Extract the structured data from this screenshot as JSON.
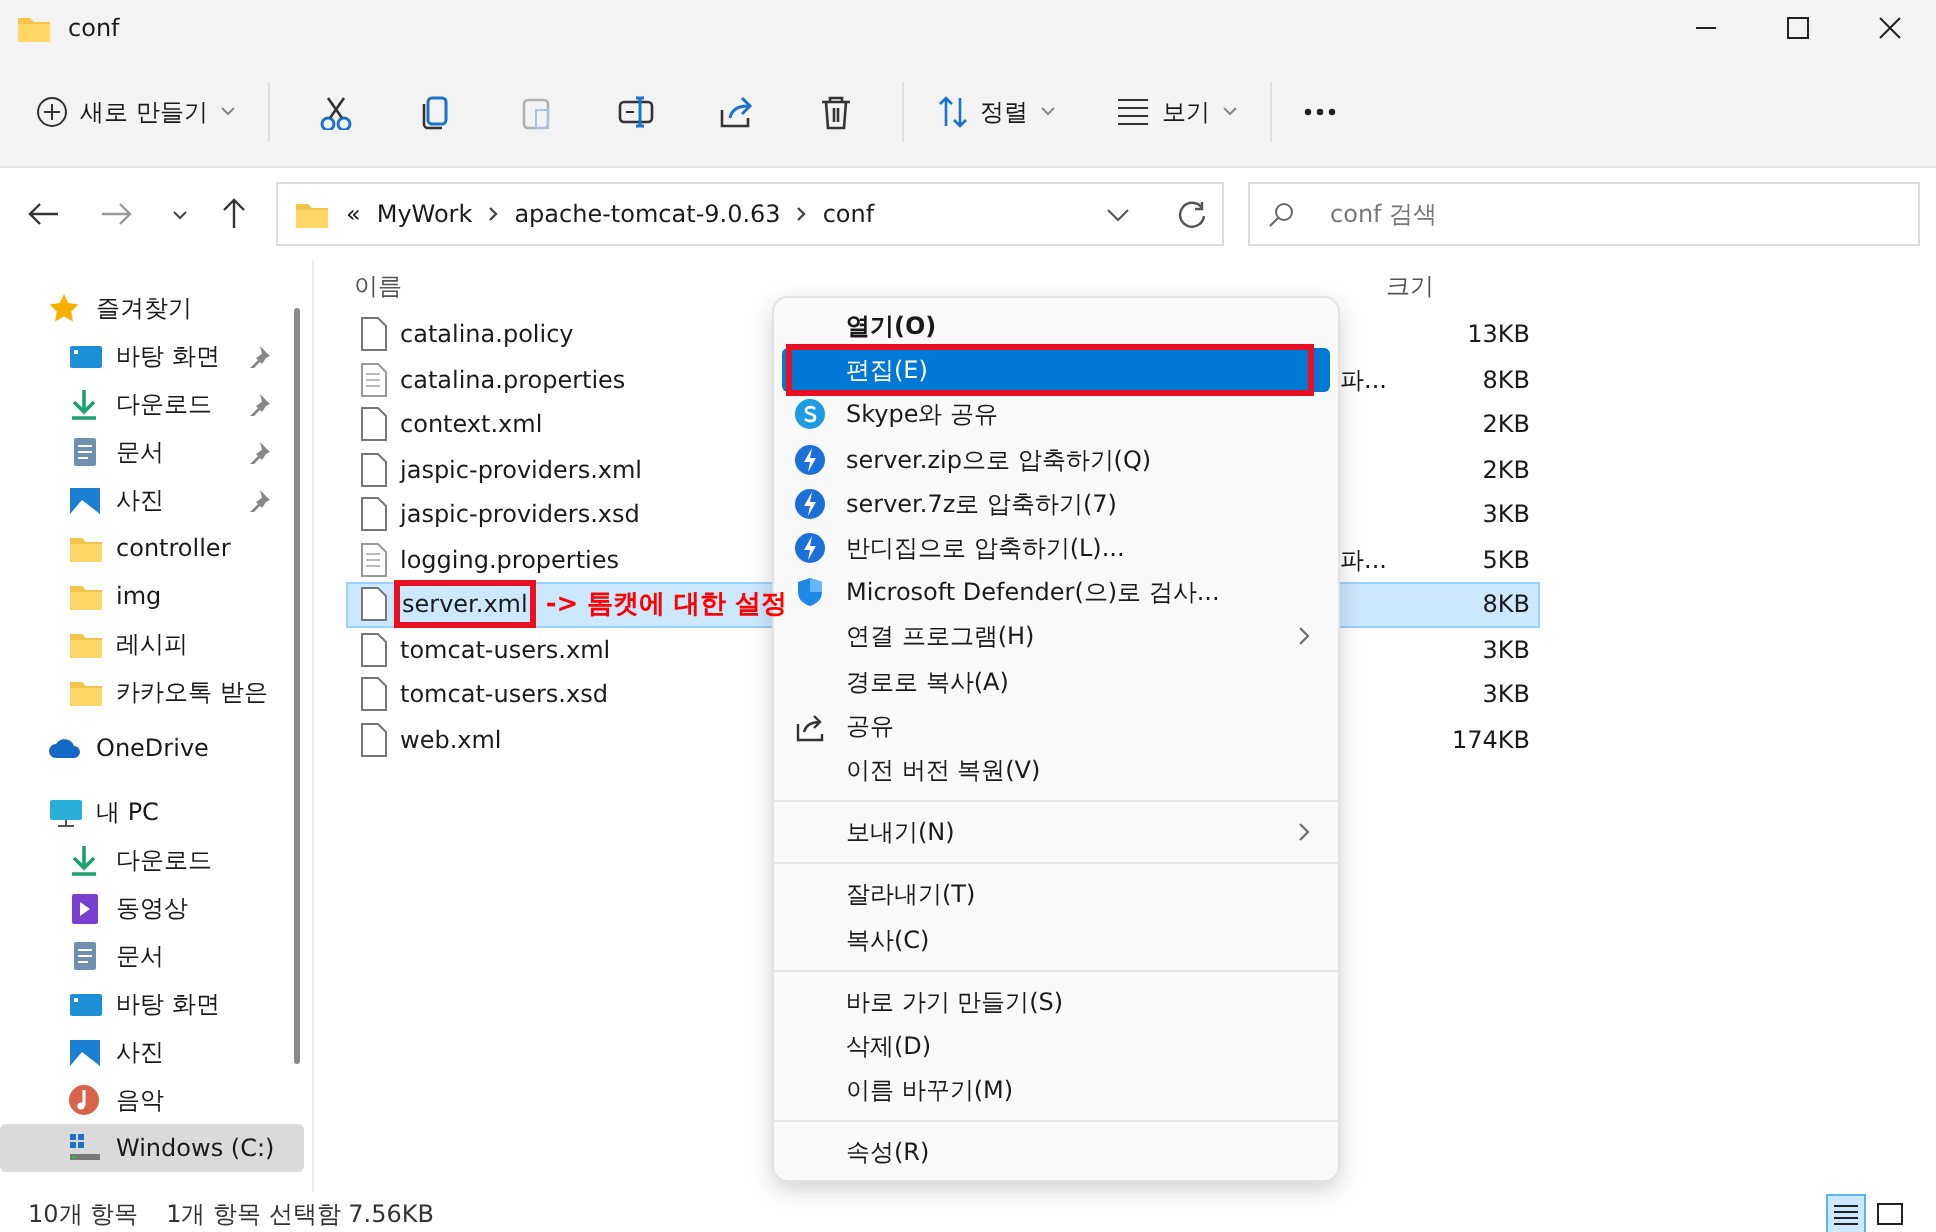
{
  "window": {
    "title": "conf"
  },
  "toolbar": {
    "new_label": "새로 만들기",
    "actions": [
      {
        "kind": "cut",
        "disabled": false
      },
      {
        "kind": "copy",
        "disabled": false
      },
      {
        "kind": "paste",
        "disabled": true
      },
      {
        "kind": "rename",
        "disabled": false
      },
      {
        "kind": "share",
        "disabled": false
      },
      {
        "kind": "delete",
        "disabled": false
      }
    ],
    "sort_label": "정렬",
    "view_label": "보기"
  },
  "address": {
    "overflow": "«",
    "crumbs": [
      "MyWork",
      "apache-tomcat-9.0.63",
      "conf"
    ],
    "search_placeholder": "conf 검색"
  },
  "sidebar": [
    {
      "label": "즐겨찾기",
      "kind": "star",
      "selected": false,
      "children": [
        {
          "label": "바탕 화면",
          "kind": "desktop",
          "pinned": true,
          "selected": false
        },
        {
          "label": "다운로드",
          "kind": "download",
          "pinned": true,
          "selected": false
        },
        {
          "label": "문서",
          "kind": "document",
          "pinned": true,
          "selected": false
        },
        {
          "label": "사진",
          "kind": "photo",
          "pinned": true,
          "selected": false
        },
        {
          "label": "controller",
          "kind": "folder",
          "pinned": false,
          "selected": false
        },
        {
          "label": "img",
          "kind": "folder",
          "pinned": false,
          "selected": false
        },
        {
          "label": "레시피",
          "kind": "folder",
          "pinned": false,
          "selected": false
        },
        {
          "label": "카카오톡 받은",
          "kind": "folder",
          "pinned": false,
          "selected": false
        }
      ]
    },
    {
      "label": "OneDrive",
      "kind": "cloud",
      "selected": false
    },
    {
      "label": "내 PC",
      "kind": "pc",
      "selected": false,
      "children": [
        {
          "label": "다운로드",
          "kind": "download",
          "pinned": false,
          "selected": false
        },
        {
          "label": "동영상",
          "kind": "video",
          "pinned": false,
          "selected": false
        },
        {
          "label": "문서",
          "kind": "document",
          "pinned": false,
          "selected": false
        },
        {
          "label": "바탕 화면",
          "kind": "desktop",
          "pinned": false,
          "selected": false
        },
        {
          "label": "사진",
          "kind": "photo",
          "pinned": false,
          "selected": false
        },
        {
          "label": "음악",
          "kind": "music",
          "pinned": false,
          "selected": false
        },
        {
          "label": "Windows  (C:)",
          "kind": "drive",
          "pinned": false,
          "selected": true
        }
      ]
    }
  ],
  "files": {
    "columns": [
      "이름",
      "크기"
    ],
    "rows": [
      {
        "name": "catalina.policy",
        "kind": "file",
        "size": "13KB",
        "selected": false
      },
      {
        "name": "catalina.properties",
        "kind": "text",
        "type": "파...",
        "size": "8KB",
        "selected": false
      },
      {
        "name": "context.xml",
        "kind": "file",
        "size": "2KB",
        "selected": false
      },
      {
        "name": "jaspic-providers.xml",
        "kind": "file",
        "size": "2KB",
        "selected": false
      },
      {
        "name": "jaspic-providers.xsd",
        "kind": "file",
        "size": "3KB",
        "selected": false
      },
      {
        "name": "logging.properties",
        "kind": "text",
        "type": "파...",
        "size": "5KB",
        "selected": false
      },
      {
        "name": "server.xml",
        "kind": "file",
        "size": "8KB",
        "selected": true,
        "annotation": "-> 톰캣에 대한 설정"
      },
      {
        "name": "tomcat-users.xml",
        "kind": "file",
        "size": "3KB",
        "selected": false
      },
      {
        "name": "tomcat-users.xsd",
        "kind": "file",
        "size": "3KB",
        "selected": false
      },
      {
        "name": "web.xml",
        "kind": "file",
        "size": "174KB",
        "selected": false
      }
    ]
  },
  "context_menu": [
    [
      {
        "label": "열기(O)",
        "kind": "plain",
        "bold": true,
        "highlighted": false,
        "submenu": false
      },
      {
        "label": "편집(E)",
        "kind": "plain",
        "bold": false,
        "highlighted": true,
        "submenu": false
      },
      {
        "label": "Skype와 공유",
        "kind": "skype",
        "bold": false,
        "highlighted": false,
        "submenu": false
      },
      {
        "label": "server.zip으로 압축하기(Q)",
        "kind": "archive",
        "bold": false,
        "highlighted": false,
        "submenu": false
      },
      {
        "label": "server.7z로 압축하기(7)",
        "kind": "archive",
        "bold": false,
        "highlighted": false,
        "submenu": false
      },
      {
        "label": "반디집으로 압축하기(L)...",
        "kind": "archive",
        "bold": false,
        "highlighted": false,
        "submenu": false
      },
      {
        "label": "Microsoft Defender(으)로 검사...",
        "kind": "scan",
        "bold": false,
        "highlighted": false,
        "submenu": false
      },
      {
        "label": "연결 프로그램(H)",
        "kind": "plain",
        "bold": false,
        "highlighted": false,
        "submenu": true
      },
      {
        "label": "경로로 복사(A)",
        "kind": "plain",
        "bold": false,
        "highlighted": false,
        "submenu": false
      },
      {
        "label": "공유",
        "kind": "share",
        "bold": false,
        "highlighted": false,
        "submenu": false
      },
      {
        "label": "이전 버전 복원(V)",
        "kind": "plain",
        "bold": false,
        "highlighted": false,
        "submenu": false
      }
    ],
    [
      {
        "label": "보내기(N)",
        "kind": "plain",
        "bold": false,
        "highlighted": false,
        "submenu": true
      }
    ],
    [
      {
        "label": "잘라내기(T)",
        "kind": "plain",
        "bold": false,
        "highlighted": false,
        "submenu": false
      },
      {
        "label": "복사(C)",
        "kind": "plain",
        "bold": false,
        "highlighted": false,
        "submenu": false
      }
    ],
    [
      {
        "label": "바로 가기 만들기(S)",
        "kind": "plain",
        "bold": false,
        "highlighted": false,
        "submenu": false
      },
      {
        "label": "삭제(D)",
        "kind": "plain",
        "bold": false,
        "highlighted": false,
        "submenu": false
      },
      {
        "label": "이름 바꾸기(M)",
        "kind": "plain",
        "bold": false,
        "highlighted": false,
        "submenu": false
      }
    ],
    [
      {
        "label": "속성(R)",
        "kind": "plain",
        "bold": false,
        "highlighted": false,
        "submenu": false
      }
    ]
  ],
  "status_bar": {
    "count": "10개 항목",
    "selection": "1개 항목 선택함 7.56KB",
    "views": [
      {
        "kind": "details",
        "selected": true
      },
      {
        "kind": "tiles",
        "selected": false
      }
    ]
  }
}
